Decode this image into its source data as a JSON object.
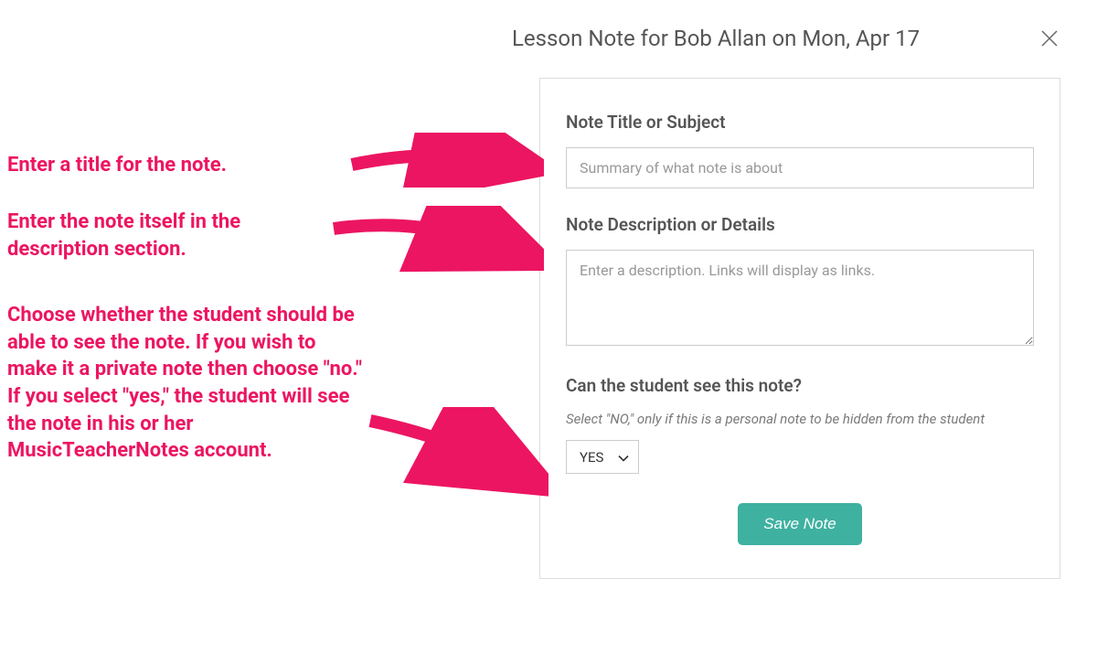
{
  "modal": {
    "title": "Lesson Note for Bob Allan on Mon, Apr 17"
  },
  "form": {
    "title_label": "Note Title or Subject",
    "title_placeholder": "Summary of what note is about",
    "description_label": "Note Description or Details",
    "description_placeholder": "Enter a description. Links will display as links.",
    "visibility_label": "Can the student see this note?",
    "visibility_helper": "Select \"NO,\" only if this is a personal note to be hidden from the student",
    "visibility_value": "YES",
    "save_button": "Save Note"
  },
  "annotations": {
    "a1": "Enter a title for the note.",
    "a2": "Enter the note itself in the description section.",
    "a3": "Choose whether the student should be able to see the note. If you wish to make it a private note then choose \"no.\" If you select \"yes,\" the student will see the note in his or her MusicTeacherNotes account."
  }
}
